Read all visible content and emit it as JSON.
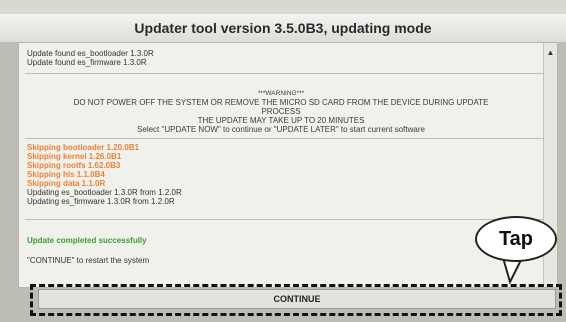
{
  "window": {
    "title": "Updater tool version 3.5.0B3, updating mode"
  },
  "log": {
    "found_lines": [
      "Update found  es_bootloader 1.3.0R",
      "Update found  es_firmware 1.3.0R"
    ],
    "warning": {
      "title": "***WARNING***",
      "lines": [
        "DO NOT POWER OFF THE SYSTEM OR REMOVE THE MICRO SD CARD FROM THE DEVICE DURING UPDATE",
        "PROCESS",
        "THE UPDATE MAY TAKE UP TO 20 MINUTES",
        "Select \"UPDATE NOW\" to continue or \"UPDATE LATER\" to start current software"
      ]
    },
    "skipping_lines": [
      "Skipping bootloader 1.20.0B1",
      "Skipping kernel 1.26.0B1",
      "Skipping rootfs 1.62.0B3",
      "Skipping hls 1.1.0B4",
      "Skipping data 1.1.0R"
    ],
    "updating_lines": [
      "Updating es_bootloader 1.3.0R from 1.2.0R",
      "Updating es_firmware 1.3.0R from 1.2.0R"
    ],
    "success": "Update completed successfully",
    "continue_hint": "\"CONTINUE\" to restart the system"
  },
  "buttons": {
    "continue_label": "CONTINUE"
  },
  "annotation": {
    "callout": "Tap"
  },
  "colors": {
    "skip": "#e8823a",
    "success": "#3e9a3a"
  },
  "icons": {
    "scroll_up": "triangle-up-icon"
  }
}
